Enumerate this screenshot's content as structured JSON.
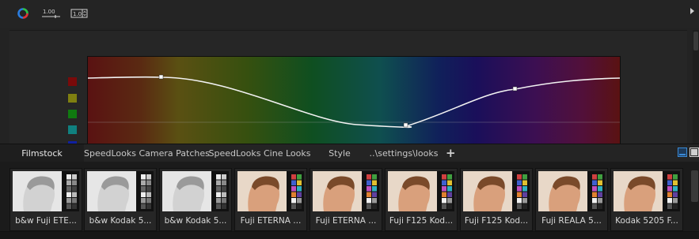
{
  "toolbar": {
    "tools": [
      {
        "name": "hue-wheel-icon"
      },
      {
        "name": "value-slider-icon",
        "label": "1.00"
      },
      {
        "name": "value-box-icon",
        "label": "1.0"
      }
    ]
  },
  "curve_editor": {
    "swatch_colors": [
      "#7a0a0a",
      "#7f7f10",
      "#107a10",
      "#10807f",
      "#1020a0"
    ]
  },
  "tabs": [
    {
      "label": "Filmstock",
      "active": true
    },
    {
      "label": "SpeedLooks Camera Patches",
      "active": false
    },
    {
      "label": "SpeedLooks Cine Looks",
      "active": false
    },
    {
      "label": "Style",
      "active": false
    },
    {
      "label": "..\\settings\\looks",
      "active": false
    }
  ],
  "add_tab_label": "+",
  "looks": [
    {
      "label": "b&w Fuji ETE...",
      "style": "bw"
    },
    {
      "label": "b&w Kodak 5...",
      "style": "bw"
    },
    {
      "label": "b&w Kodak 5...",
      "style": "bw"
    },
    {
      "label": "Fuji ETERNA ...",
      "style": "color"
    },
    {
      "label": "Fuji ETERNA ...",
      "style": "color"
    },
    {
      "label": "Fuji F125 Kod...",
      "style": "color"
    },
    {
      "label": "Fuji F125 Kod...",
      "style": "color"
    },
    {
      "label": "Fuji REALA 5...",
      "style": "color"
    },
    {
      "label": "Kodak 5205 F...",
      "style": "color"
    }
  ]
}
